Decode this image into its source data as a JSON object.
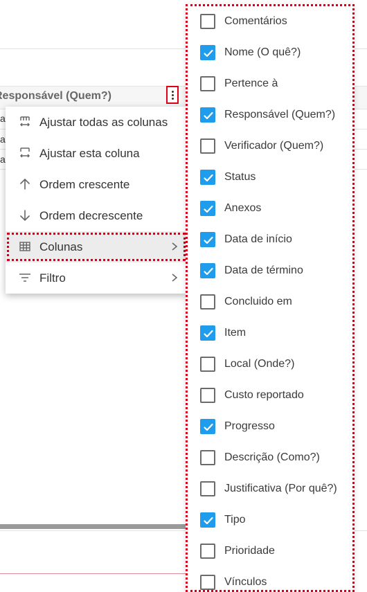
{
  "grid": {
    "column_header": "Responsável (Quem?)",
    "row_stubs": [
      "a",
      "a",
      "a"
    ]
  },
  "context_menu": {
    "items": [
      {
        "label": "Ajustar todas as colunas",
        "icon": "autosize-all-icon",
        "has_submenu": false
      },
      {
        "label": "Ajustar esta coluna",
        "icon": "autosize-column-icon",
        "has_submenu": false
      },
      {
        "label": "Ordem crescente",
        "icon": "arrow-up-icon",
        "has_submenu": false
      },
      {
        "label": "Ordem decrescente",
        "icon": "arrow-down-icon",
        "has_submenu": false
      },
      {
        "label": "Colunas",
        "icon": "columns-grid-icon",
        "has_submenu": true,
        "active": true
      },
      {
        "label": "Filtro",
        "icon": "filter-icon",
        "has_submenu": true
      }
    ]
  },
  "columns_panel": {
    "items": [
      {
        "label": "Comentários",
        "checked": false
      },
      {
        "label": "Nome (O quê?)",
        "checked": true
      },
      {
        "label": "Pertence à",
        "checked": false
      },
      {
        "label": "Responsável (Quem?)",
        "checked": true
      },
      {
        "label": "Verificador (Quem?)",
        "checked": false
      },
      {
        "label": "Status",
        "checked": true
      },
      {
        "label": "Anexos",
        "checked": true
      },
      {
        "label": "Data de início",
        "checked": true
      },
      {
        "label": "Data de término",
        "checked": true
      },
      {
        "label": "Concluido em",
        "checked": false
      },
      {
        "label": "Item",
        "checked": true
      },
      {
        "label": "Local (Onde?)",
        "checked": false
      },
      {
        "label": "Custo reportado",
        "checked": false
      },
      {
        "label": "Progresso",
        "checked": true
      },
      {
        "label": "Descrição (Como?)",
        "checked": false
      },
      {
        "label": "Justificativa (Por quê?)",
        "checked": false
      },
      {
        "label": "Tipo",
        "checked": true
      },
      {
        "label": "Prioridade",
        "checked": false
      },
      {
        "label": "Vínculos",
        "checked": false
      }
    ]
  },
  "colors": {
    "checkbox_checked": "#1f9cec",
    "highlight_border": "#d0021b"
  }
}
